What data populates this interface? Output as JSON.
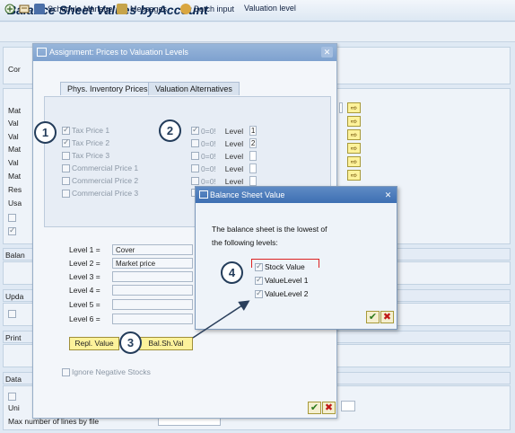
{
  "app": {
    "title": "Balance Sheet Values by Account"
  },
  "toolbar": {
    "schedule_label": "Schedule Manager",
    "messages_label": "Messages",
    "batch_label": "Batch input",
    "valuation_label": "Valuation level"
  },
  "background": {
    "labels": [
      "Cor",
      "Mat",
      "Val",
      "Val",
      "Mat",
      "Val",
      "Mat",
      "Res",
      "Usa",
      "Balan",
      "Upda",
      "Print",
      "Data",
      "Uni"
    ],
    "max_lines_label": "Max number of lines by file"
  },
  "dialog": {
    "title": "Assignment: Prices to Valuation Levels",
    "tabs": [
      "Phys. Inventory Prices",
      "Valuation Alternatives"
    ],
    "prices": [
      {
        "label": "Tax Price 1",
        "checked": true
      },
      {
        "label": "Tax Price 2",
        "checked": true
      },
      {
        "label": "Tax Price 3",
        "checked": false
      },
      {
        "label": "Commercial Price 1",
        "checked": false
      },
      {
        "label": "Commercial Price 2",
        "checked": false
      },
      {
        "label": "Commercial Price 3",
        "checked": false
      }
    ],
    "flags": [
      {
        "label": "0=0!",
        "checked": true,
        "level_label": "Level",
        "level": "1"
      },
      {
        "label": "0=0!",
        "checked": false,
        "level_label": "Level",
        "level": "2"
      },
      {
        "label": "0=0!",
        "checked": false,
        "level_label": "Level",
        "level": ""
      },
      {
        "label": "0=0!",
        "checked": false,
        "level_label": "Level",
        "level": ""
      },
      {
        "label": "0=0!",
        "checked": false,
        "level_label": "Level",
        "level": ""
      },
      {
        "label": "",
        "checked": false,
        "level_label": "",
        "level": ""
      }
    ],
    "levels": [
      {
        "label": "Level 1 =",
        "value": "Cover"
      },
      {
        "label": "Level 2 =",
        "value": "Market price"
      },
      {
        "label": "Level 3 =",
        "value": ""
      },
      {
        "label": "Level 4 =",
        "value": ""
      },
      {
        "label": "Level 5 =",
        "value": ""
      },
      {
        "label": "Level 6 =",
        "value": ""
      }
    ],
    "repl_value_label": "Repl. Value",
    "bal_sh_val_label": "Bal.Sh.Val",
    "ignore_neg_label": "Ignore Negative Stocks"
  },
  "bsv_dialog": {
    "title": "Balance Sheet Value",
    "text_line1": "The balance sheet is the lowest of",
    "text_line2": "the following levels:",
    "options": [
      {
        "label": "Stock Value",
        "checked": true
      },
      {
        "label": "ValueLevel 1",
        "checked": true
      },
      {
        "label": "ValueLevel 2",
        "checked": true
      }
    ]
  },
  "callouts": [
    "1",
    "2",
    "3",
    "4"
  ],
  "icons": {
    "close": "close-icon",
    "arrow": "arrow-right-icon",
    "confirm": "checkmark-icon",
    "cancel": "cancel-icon"
  }
}
